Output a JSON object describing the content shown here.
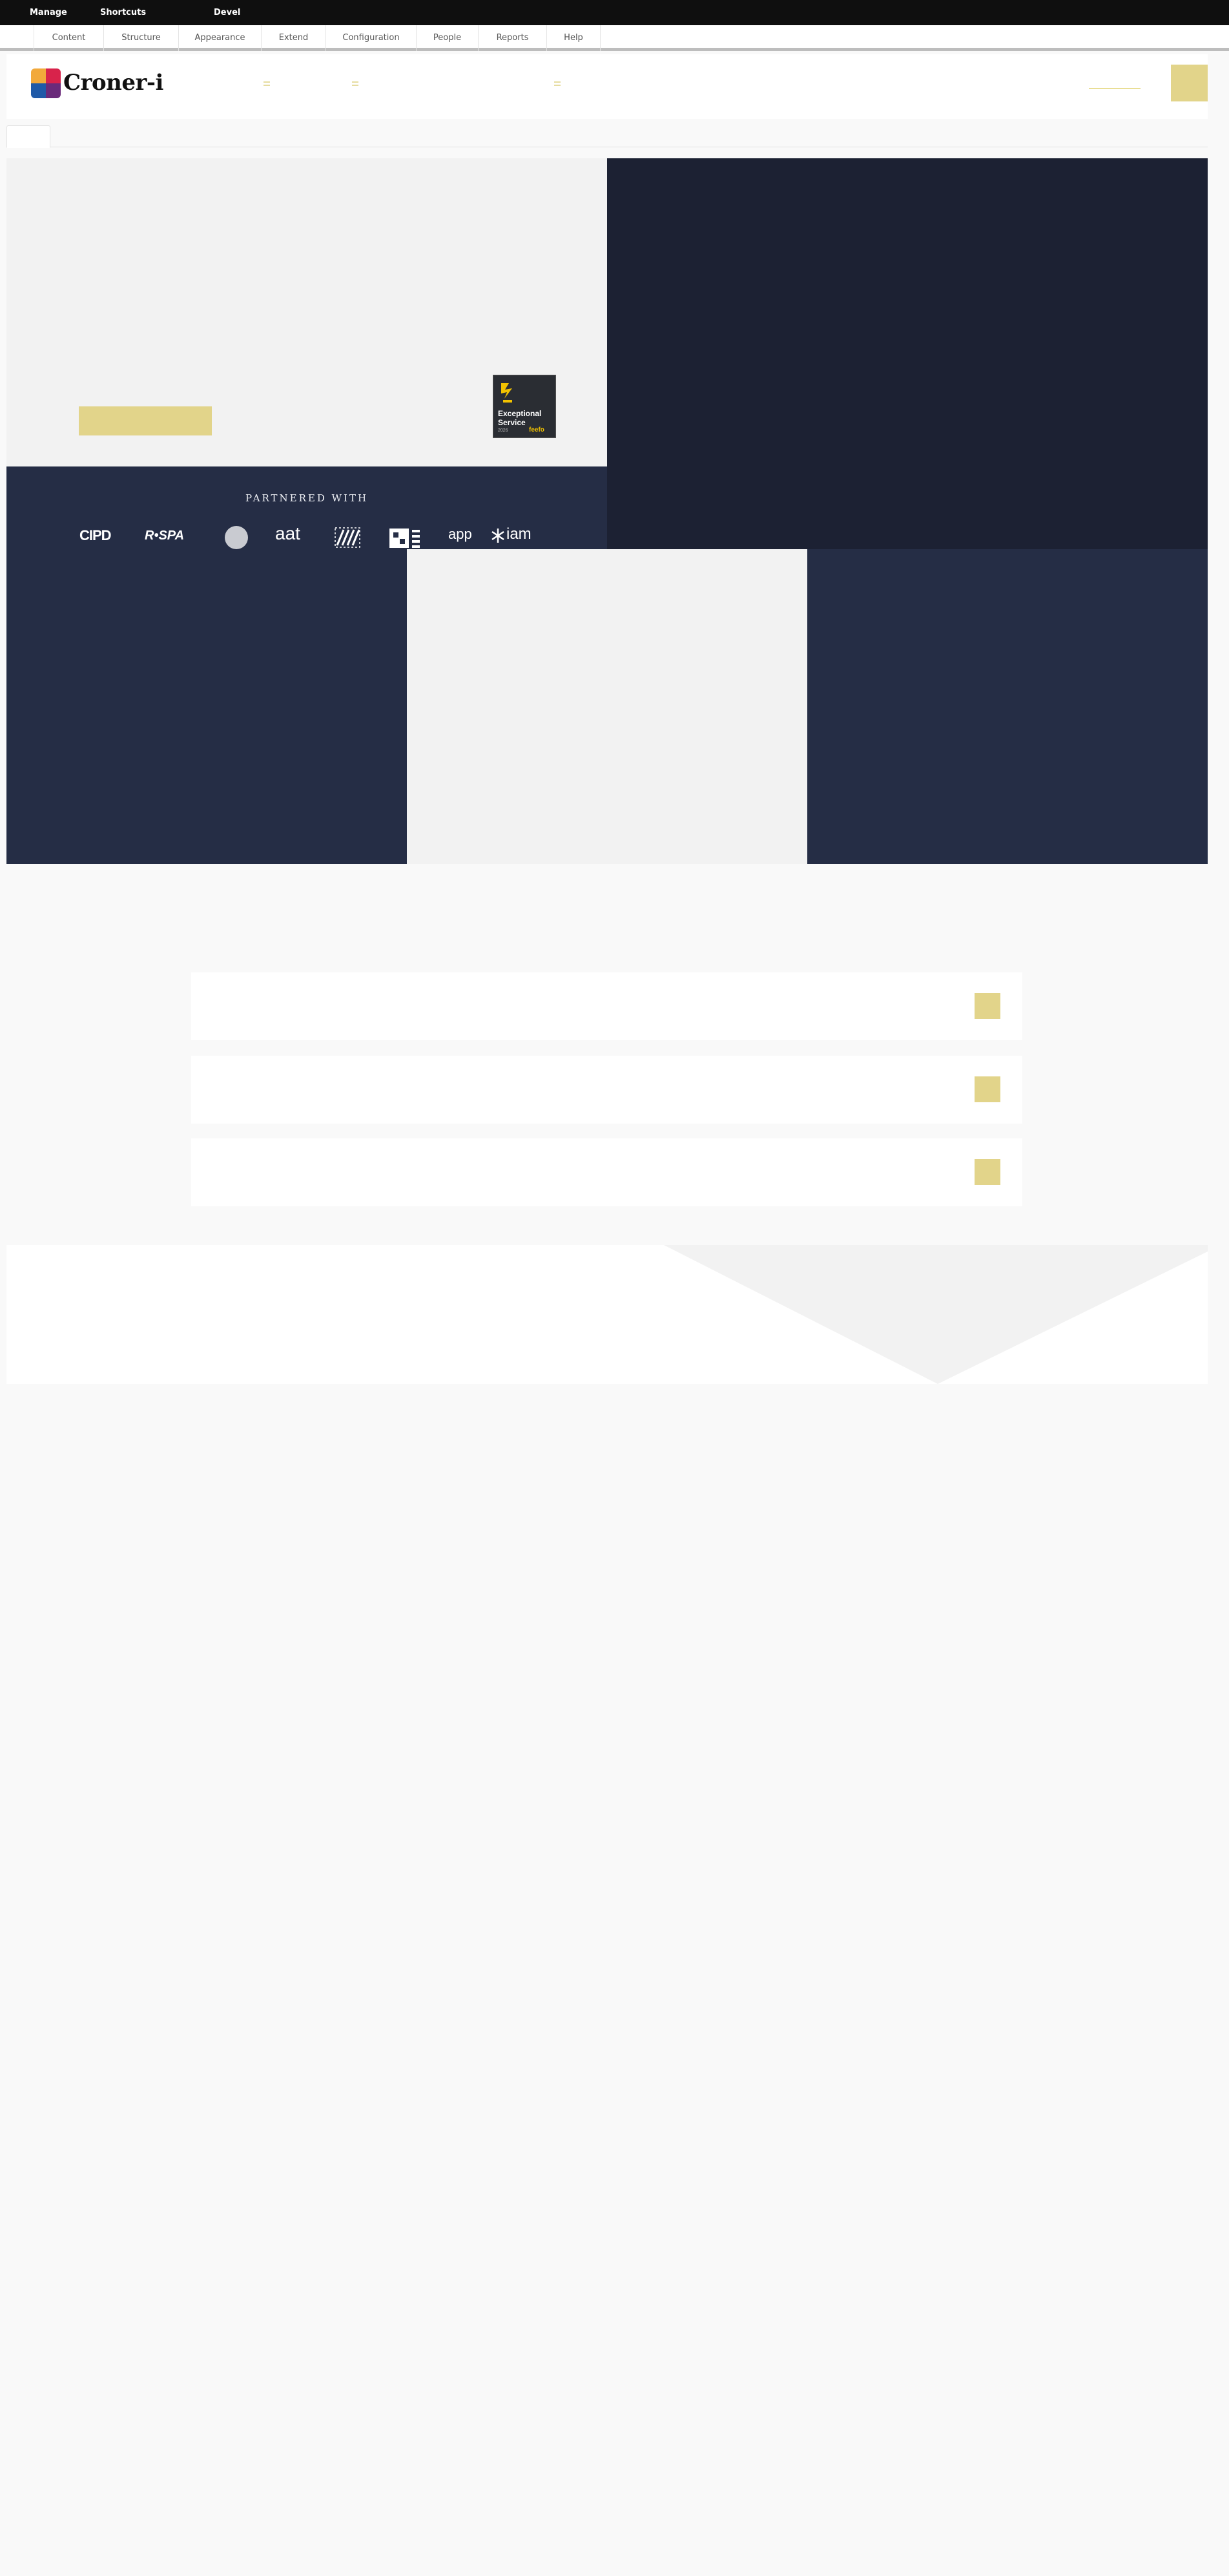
{
  "toolbar": {
    "manage": "Manage",
    "shortcuts": "Shortcuts",
    "devel": "Devel"
  },
  "tray": {
    "items": [
      "Content",
      "Structure",
      "Appearance",
      "Extend",
      "Configuration",
      "People",
      "Reports",
      "Help"
    ]
  },
  "header": {
    "logo_text": "Croner-i"
  },
  "badge": {
    "line1": "Exceptional",
    "line2": "Service",
    "year": "2026",
    "brand": "feefo"
  },
  "partners": {
    "title": "PARTNERED WITH",
    "logos": [
      "CIPD",
      "R•SPA",
      "aat",
      "app",
      "iam"
    ]
  },
  "colors": {
    "toolbar_bg": "#0f0f0f",
    "accent": "#e2d48a",
    "navy": "#1c2133",
    "navy_light": "#252d45",
    "panel_grey": "#f2f2f2"
  }
}
